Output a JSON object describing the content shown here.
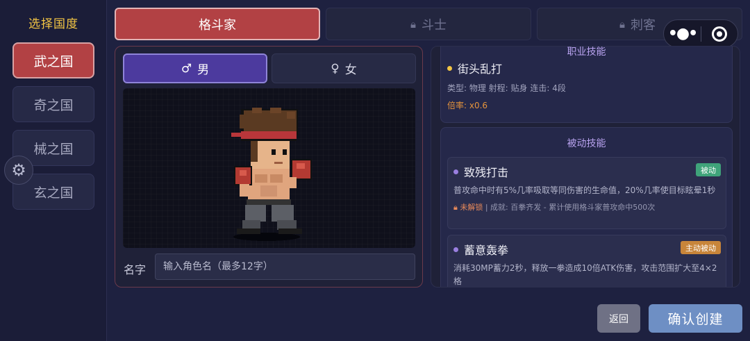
{
  "sidebar": {
    "title": "选择国度",
    "countries": [
      {
        "label": "武之国",
        "active": true
      },
      {
        "label": "奇之国",
        "active": false
      },
      {
        "label": "械之国",
        "active": false
      },
      {
        "label": "玄之国",
        "active": false
      }
    ],
    "settings_icon": "gear-icon"
  },
  "class_tabs": [
    {
      "label": "格斗家",
      "active": true,
      "locked": false
    },
    {
      "label": "斗士",
      "active": false,
      "locked": true
    },
    {
      "label": "刺客",
      "active": false,
      "locked": true
    }
  ],
  "capsule": {
    "more_icon": "more-dots-icon",
    "close_icon": "target-ring-icon"
  },
  "character": {
    "genders": [
      {
        "symbol": "♂",
        "label": "男",
        "active": true
      },
      {
        "symbol": "♀",
        "label": "女",
        "active": false
      }
    ],
    "name_label": "名字",
    "name_placeholder": "输入角色名（最多12字）",
    "name_value": ""
  },
  "skills": {
    "class_section_title": "职业技能",
    "class_skill": {
      "name": "街头乱打",
      "meta": "类型: 物理  射程: 贴身  连击: 4段",
      "multiplier": "倍率: x0.6"
    },
    "passive_section_title": "被动技能",
    "passives": [
      {
        "name": "致残打击",
        "badge": "被动",
        "badge_color": "#3fa37a",
        "desc": "普攻命中时有5%几率吸取等同伤害的生命值，20%几率使目标眩晕1秒",
        "unlock_status": "未解锁",
        "unlock_text": " | 成就: 百拳齐发 - 累计使用格斗家普攻命中500次"
      },
      {
        "name": "蓄意轰拳",
        "badge": "主动被动",
        "badge_color": "#c8853a",
        "desc": "消耗30MP蓄力2秒，释放一拳造成10倍ATK伤害，攻击范围扩大至4×2格"
      }
    ]
  },
  "buttons": {
    "back": "返回",
    "confirm": "确认创建"
  },
  "colors": {
    "accent_red": "#b24144",
    "accent_purple": "#4c3a9e",
    "gold": "#f3c544",
    "confirm_blue": "#6e8fc4"
  }
}
